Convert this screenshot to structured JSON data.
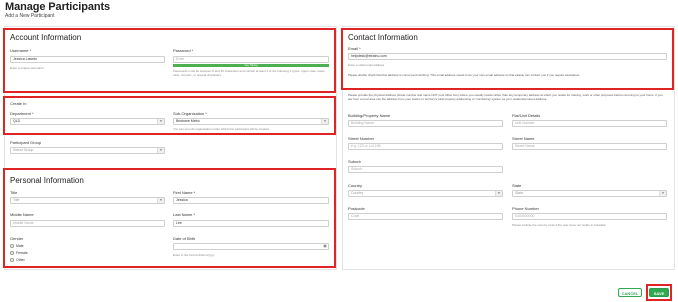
{
  "page": {
    "title": "Manage Participants",
    "subtitle": "Add a New Participant"
  },
  "account": {
    "title": "Account Information",
    "username_label": "Username *",
    "username_value": "Jessica Lawetu",
    "username_hint": "Enter a unique username",
    "password_label": "Password *",
    "password_placeholder": "Enter",
    "password_strength": "Very Strong",
    "password_strength_level": 1.0,
    "password_hint": "Passwords must be between 8 and 30 characters and contain at least 3 of the following 4 types: upper case, lower case, numeric, or special characters"
  },
  "create_in": {
    "title": "Create In",
    "department_label": "Department *",
    "department_value": "QLD",
    "suborg_label": "Sub-Organization *",
    "suborg_value": "Brisbane Metro",
    "suborg_hint": "You can set sub-organisation under which this participant will be created",
    "group_label": "Participant Group",
    "group_placeholder": "Select Group"
  },
  "personal": {
    "title": "Personal Information",
    "title_label": "Title",
    "title_placeholder": "Title",
    "firstname_label": "First Name *",
    "firstname_value": "Jessica",
    "middlename_label": "Middle Name",
    "middlename_placeholder": "Middle Name",
    "lastname_label": "Last Name *",
    "lastname_value": "Lee",
    "gender_label": "Gender",
    "gender_options": [
      "Male",
      "Female",
      "Other"
    ],
    "dob_label": "Date of Birth",
    "dob_hint": "Enter in the format dd/mm/yyyy"
  },
  "contact": {
    "title": "Contact Information",
    "email_label": "Email *",
    "email_value": "helpdesk@etrainu.com",
    "email_hint": "Enter a valid email address",
    "email_note": "Please double check that this address is correct and working. This email address needs to be your own email address so that etrainu can contact you if you require assistance.",
    "address_note": "Please provide the physical address (street number and name NOT post office box) where you usually reside rather than any temporary address at which you reside for training, work or other purposes before returning to your home. If you are from a rural area use the address from your state's or territory's rural property addressing or 'numbering' system as your residential street address.",
    "building_label": "Building/Property Name",
    "building_placeholder": "Building Name",
    "flat_label": "Flat/Unit Details",
    "flat_placeholder": "Unit Number",
    "street_number_label": "Street Number",
    "street_number_placeholder": "e.g. 123 or Lot 198",
    "street_name_label": "Street Name",
    "street_name_placeholder": "Street Name",
    "suburb_label": "Suburb",
    "suburb_placeholder": "Suburb",
    "country_label": "Country",
    "country_placeholder": "Country",
    "state_label": "State",
    "state_placeholder": "State",
    "postcode_label": "Postcode",
    "postcode_placeholder": "Code",
    "phone_label": "Phone Number",
    "phone_placeholder": "0400000000",
    "phone_hint": "Please include the country code if the user does not reside in Australia"
  },
  "actions": {
    "cancel": "CANCEL",
    "save": "SAVE"
  },
  "colors": {
    "highlight": "#e02424",
    "accent": "#33a852"
  }
}
